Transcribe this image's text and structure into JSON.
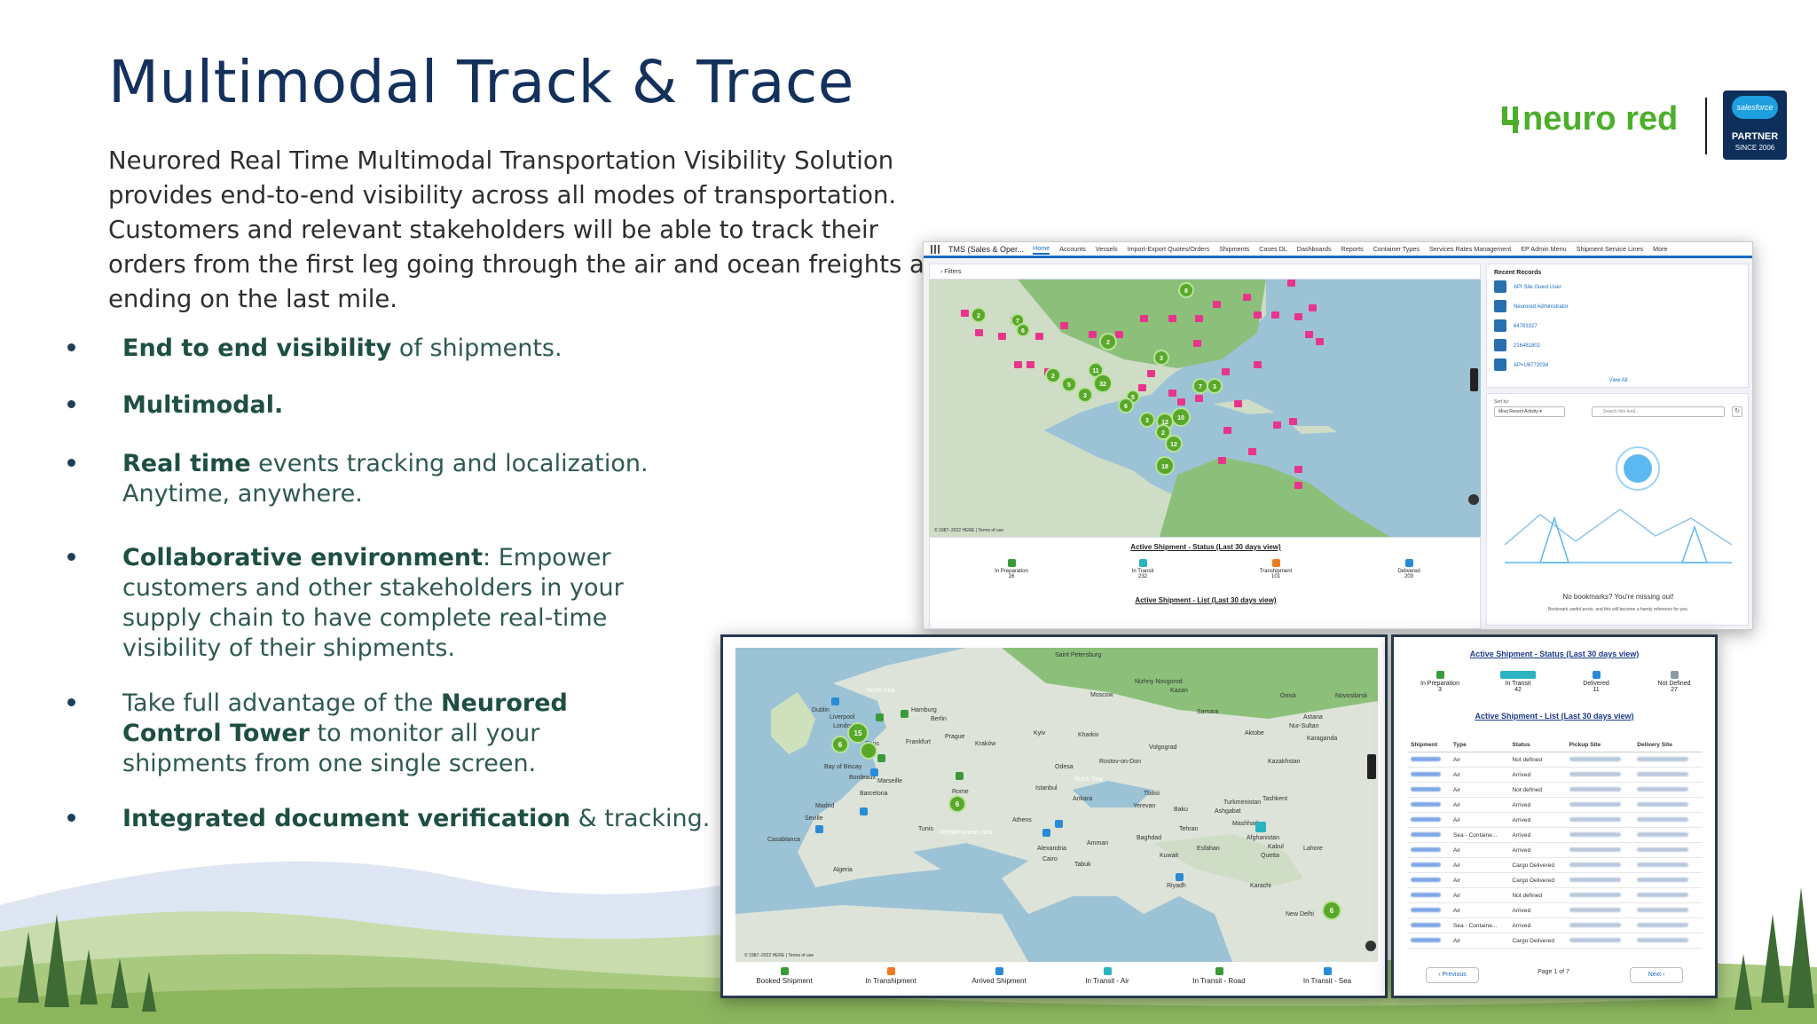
{
  "title": "Multimodal Track & Trace",
  "intro": "Neurored Real Time Multimodal Transportation Visibility Solution provides end-to-end visibility across all modes of transportation. Customers and relevant stakeholders will be able to track their orders from the first leg going through the air and ocean freights and ending on the last mile.",
  "bullets": [
    {
      "bold": "End to end visibility",
      "rest": " of shipments."
    },
    {
      "bold": "Multimodal.",
      "rest": ""
    },
    {
      "bold": "Real time",
      "rest": " events tracking and localization. Anytime, anywhere."
    },
    {
      "bold": "Collaborative environment",
      "rest": ": Empower customers and other stakeholders in your supply chain to have complete real-time visibility of their shipments."
    },
    {
      "pre": "Take full advantage of the ",
      "bold": "Neurored Control Tower",
      "rest": " to monitor all your shipments from one single screen."
    },
    {
      "bold": "Integrated document verification",
      "rest": " & tracking."
    }
  ],
  "logo": {
    "brand": "neuro red",
    "partner_cloud": "salesforce",
    "partner_label": "PARTNER",
    "partner_since": "SINCE 2006"
  },
  "colors": {
    "title": "#13315c",
    "brand_green": "#4caf2a",
    "brand_red": "#c8102e",
    "marker_green": "#5aa829",
    "marker_pink": "#e8358b",
    "nav_blue": "#1b6bc4"
  },
  "shot1": {
    "app_name": "TMS (Sales & Oper...",
    "tabs": [
      "Home",
      "Accounts",
      "Vessels",
      "Import-Export Quotes/Orders",
      "Shipments",
      "Cases DL",
      "Dashboards",
      "Reports",
      "Container Types",
      "Services Rates Management",
      "EP Admin Menu",
      "Shipment Service Lines",
      "More"
    ],
    "filters_label": "Filters",
    "map_credit": "© 1987–2022 HERE | Terms of use",
    "status_title": "Active Shipment - Status (Last 30 days view)",
    "list_title": "Active Shipment - List (Last 30 days view)",
    "statuses": [
      {
        "label": "In Preparation",
        "count": "16",
        "color": "#3a9a3a"
      },
      {
        "label": "In Transit",
        "count": "232",
        "color": "#2bb3c0"
      },
      {
        "label": "Transhipment",
        "count": "101",
        "color": "#f07b22"
      },
      {
        "label": "Delivered",
        "count": "203",
        "color": "#2a8ad6"
      }
    ],
    "clusters": [
      "8",
      "2",
      "7",
      "6",
      "2",
      "3",
      "11",
      "2",
      "5",
      "32",
      "3",
      "5",
      "6",
      "7",
      "3",
      "3",
      "12",
      "10",
      "2",
      "12",
      "18"
    ],
    "recent_records_title": "Recent Records",
    "recent_records": [
      "API Site Guest User",
      "Neurored Administrator",
      "64783327",
      "216481802",
      "AP+U6772034"
    ],
    "view_all": "View All",
    "sort_by_label": "Sort by:",
    "sort_value": "Most Recent Activity",
    "search_placeholder": "Search this feed...",
    "empty_title": "No bookmarks? You're missing out!",
    "empty_sub": "Bookmark useful posts, and this will become a handy reference for you."
  },
  "shot2": {
    "cities": [
      "Saint Petersburg",
      "North Sea",
      "Hamburg",
      "Berlin",
      "Dublin",
      "Liverpool",
      "London",
      "Paris",
      "Frankfurt",
      "Prague",
      "Kraków",
      "Kyiv",
      "Kharkiv",
      "Moscow",
      "Nizhny Novgorod",
      "Kazan",
      "Samara",
      "Volgograd",
      "Rostov-on-Don",
      "Odesa",
      "Bay of Biscay",
      "Bordeaux",
      "Marseille",
      "Barcelona",
      "Madrid",
      "Seville",
      "Casablanca",
      "Algeria",
      "Rome",
      "Tunis",
      "Mediterranean Sea",
      "Athens",
      "Istanbul",
      "Ankara",
      "Black Sea",
      "Tbilisi",
      "Yerevan",
      "Baku",
      "Tehran",
      "Baghdad",
      "Kuwait",
      "Riyadh",
      "Cairo",
      "Alexandria",
      "Amman",
      "Tabuk",
      "Esfahan",
      "Mashhad",
      "Ashgabat",
      "Tashkent",
      "Turkmenistan",
      "Afghanistan",
      "Kabul",
      "Lahore",
      "New Delhi",
      "Karachi",
      "Quetta",
      "Omsk",
      "Novosibirsk",
      "Astana",
      "Karaganda",
      "Aktobe",
      "Kazakhstan",
      "Nur-Sultan"
    ],
    "clusters": [
      "15",
      "6",
      "6",
      "6"
    ],
    "map_credit": "© 1987–2022 HERE | Terms of use",
    "legend": [
      {
        "label": "Booked Shipment",
        "color": "#3a9a3a"
      },
      {
        "label": "In Transhipment",
        "color": "#f07b22"
      },
      {
        "label": "Arrived Shipment",
        "color": "#2a8ad6"
      },
      {
        "label": "In Transit - Air",
        "color": "#2bb3c0"
      },
      {
        "label": "In Transit - Road",
        "color": "#3a9a3a"
      },
      {
        "label": "In Transit - Sea",
        "color": "#2a8ad6"
      }
    ]
  },
  "shot3": {
    "status_title": "Active Shipment - Status (Last 30 days view)",
    "list_title": "Active Shipment - List (Last 30 days view)",
    "statuses": [
      {
        "label": "In Preparation",
        "count": "3",
        "color": "#3a9a3a"
      },
      {
        "label": "In Transit",
        "count": "42",
        "color": "#2bb3c0"
      },
      {
        "label": "Delivered",
        "count": "11",
        "color": "#2a8ad6"
      },
      {
        "label": "Not Defined",
        "count": "27",
        "color": "#8c9aa8"
      }
    ],
    "columns": [
      "Shipment",
      "Type",
      "Status",
      "Pickup Site",
      "Delivery Site"
    ],
    "rows": [
      {
        "type": "Air",
        "status": "Not defined"
      },
      {
        "type": "Air",
        "status": "Arrived"
      },
      {
        "type": "Air",
        "status": "Not defined"
      },
      {
        "type": "Air",
        "status": "Arrived"
      },
      {
        "type": "Air",
        "status": "Arrived"
      },
      {
        "type": "Sea - Containe...",
        "status": "Arrived"
      },
      {
        "type": "Air",
        "status": "Arrived"
      },
      {
        "type": "Air",
        "status": "Cargo Delivered"
      },
      {
        "type": "Air",
        "status": "Cargo Delivered"
      },
      {
        "type": "Air",
        "status": "Not defined"
      },
      {
        "type": "Air",
        "status": "Arrived"
      },
      {
        "type": "Sea - Containe...",
        "status": "Arrived"
      },
      {
        "type": "Air",
        "status": "Cargo Delivered"
      }
    ],
    "previous": "Previous",
    "page": "Page 1 of 7",
    "next": "Next"
  }
}
